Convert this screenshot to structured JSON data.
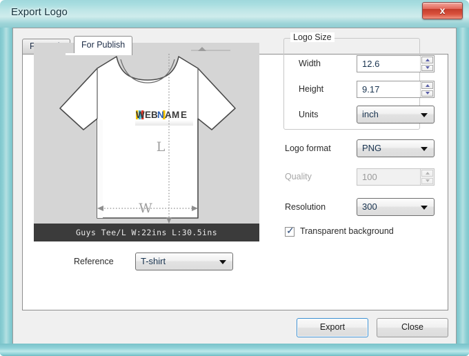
{
  "window": {
    "title": "Export Logo",
    "close_icon": "close-x-icon",
    "close_glyph": "x",
    "frame_color": "#8fcdd2",
    "close_button_color": "#c43d2c"
  },
  "tabs": [
    {
      "label": "For Web",
      "active": false
    },
    {
      "label": "For Publish",
      "active": true
    }
  ],
  "preview": {
    "caption": "Guys Tee/L  W:22ins  L:30.5ins",
    "width_guide_label": "W",
    "length_guide_label": "L",
    "background_color": "#d5d5d5",
    "caption_background": "#3b3b3b",
    "logo": {
      "letters": [
        {
          "char": "W",
          "color": "#3a3a3a"
        },
        {
          "char": "E",
          "color": "#3a3a3a"
        },
        {
          "char": "B",
          "color": "#3a3a3a"
        },
        {
          "char": "N",
          "color": "#2a5fb4"
        },
        {
          "char": "A",
          "color": "#3a3a3a"
        },
        {
          "char": "M",
          "color": "#3a3a3a"
        },
        {
          "char": "E",
          "color": "#3a3a3a"
        }
      ],
      "accent_colors": [
        "#f2c200",
        "#3fb8d8",
        "#e0392b"
      ]
    }
  },
  "reference": {
    "label": "Reference",
    "value": "T-shirt"
  },
  "logo_size": {
    "legend": "Logo Size",
    "width": {
      "label": "Width",
      "value": "12.6"
    },
    "height": {
      "label": "Height",
      "value": "9.17"
    },
    "units": {
      "label": "Units",
      "value": "inch"
    }
  },
  "logo_format": {
    "label": "Logo format",
    "value": "PNG"
  },
  "quality": {
    "label": "Quality",
    "value": "100",
    "disabled": true
  },
  "resolution": {
    "label": "Resolution",
    "value": "300"
  },
  "transparent_background": {
    "label": "Transparent background",
    "checked": true,
    "check_glyph": "✓"
  },
  "buttons": {
    "export": "Export",
    "close": "Close"
  }
}
